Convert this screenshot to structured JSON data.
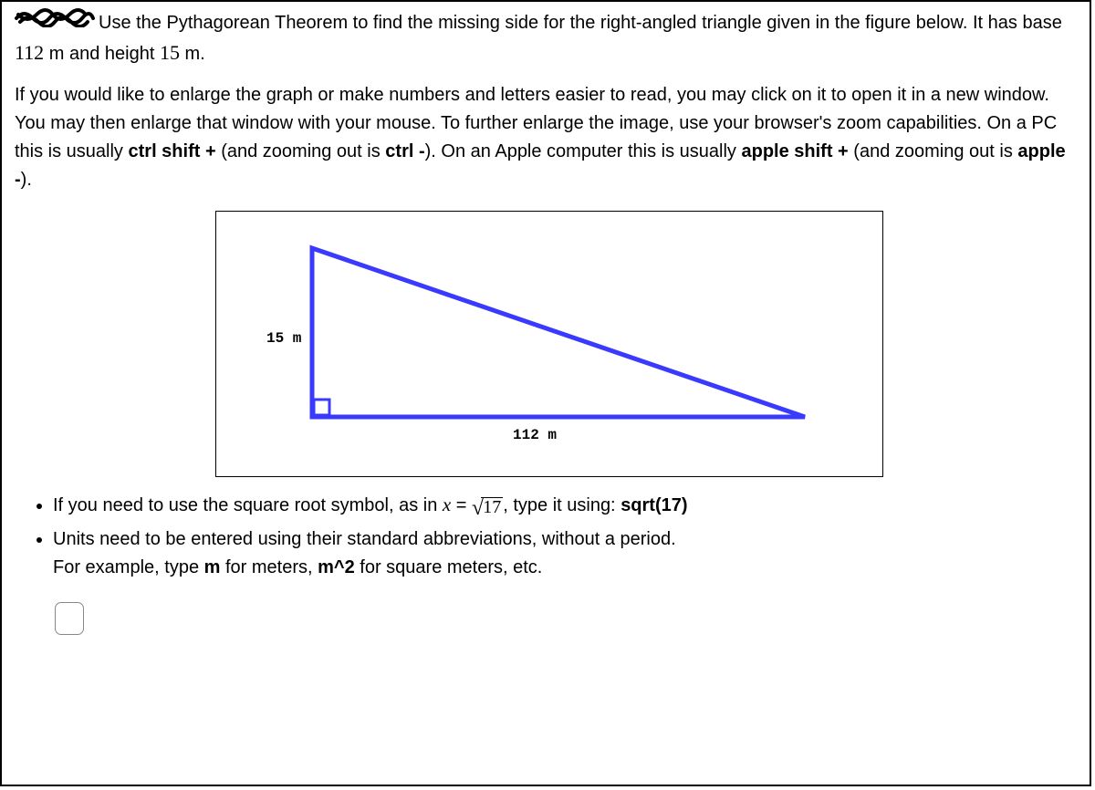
{
  "problem": {
    "intro_a": "Use the Pythagorean Theorem to find the missing side for the right-angled triangle given in the figure below. It has base ",
    "base_val": "112",
    "intro_b": " m and height ",
    "height_val": "15",
    "intro_c": " m."
  },
  "enlarge_para": {
    "t1": "If you would like to enlarge the graph or make numbers and letters easier to read, you may click on it to open it in a new window. You may then enlarge that window with your mouse. To further enlarge the image, use your browser's zoom capabilities. On a PC this is usually ",
    "b1": "ctrl shift +",
    "t2": " (and zooming out is ",
    "b2": "ctrl -",
    "t3": "). On an Apple computer this is usually ",
    "b3": "apple shift +",
    "t4": " (and zooming out is ",
    "b4": "apple -",
    "t5": ")."
  },
  "figure": {
    "height_label": "15 m",
    "base_label": "112 m"
  },
  "hints": {
    "h1a": "If you need to use the square root symbol, as in ",
    "h1x": "x",
    "h1eq": " = ",
    "h1radval": "17",
    "h1b": ", type it using: ",
    "h1c": "sqrt(17)",
    "h2": "Units need to be entered using their standard abbreviations, without a period.",
    "h2b_a": "For example, type ",
    "h2b_b": "m",
    "h2b_c": " for meters, ",
    "h2b_d": "m^2",
    "h2b_e": " for square meters, etc."
  },
  "answer_value": ""
}
